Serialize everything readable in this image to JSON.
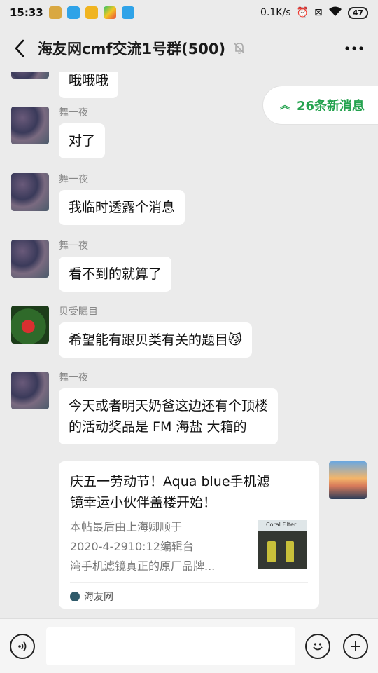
{
  "status": {
    "time": "15:33",
    "net_speed": "0.1K/s",
    "battery": "47"
  },
  "header": {
    "title": "海友网cmf交流1号群(500)"
  },
  "new_messages": "26条新消息",
  "messages": [
    {
      "text": "哦哦哦"
    },
    {
      "name": "舞一夜",
      "text": "对了"
    },
    {
      "name": "舞一夜",
      "text": "我临时透露个消息"
    },
    {
      "name": "舞一夜",
      "text": "看不到的就算了"
    },
    {
      "name": "贝受瞩目",
      "text": "希望能有跟贝类有关的题目"
    },
    {
      "name": "舞一夜",
      "text_line1": "今天或者明天奶爸这边还有个顶楼",
      "text_line2": "的活动奖品是 FM 海盐 大箱的"
    }
  ],
  "card": {
    "title_line1": "庆五一劳动节！Aqua blue手机滤",
    "title_line2": "镜幸运小伙伴盖楼开始！",
    "desc_line1": "本帖最后由上海卿顺于",
    "desc_line2": "2020-4-2910:12编辑台",
    "desc_line3": "湾手机滤镜真正的原厂品牌...",
    "thumb_label": "Coral Filter",
    "source": "海友网"
  },
  "icons": {
    "back": "back-arrow-icon",
    "mute": "mute-bell-icon",
    "more": "more-dots-icon",
    "voice": "voice-icon",
    "emoji": "emoji-icon",
    "plus": "plus-icon"
  },
  "colors": {
    "accent_green": "#24a24e",
    "background": "#ebebeb"
  }
}
